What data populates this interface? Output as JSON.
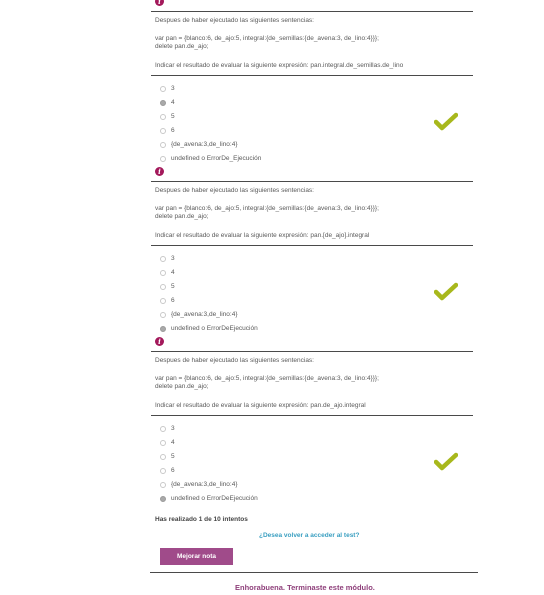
{
  "questions": [
    {
      "intro": "Despues de haber ejecutado las siguientes sentencias:",
      "code_line1": "var pan = {blanco:6, de_ajo:5, integral:{de_semillas:{de_avena:3, de_lino:4}}};",
      "code_line2": "delete pan.de_ajo;",
      "prompt": "Indicar el resultado de evaluar la siguiente expresión: pan.integral.de_semillas.de_lino",
      "options": [
        "3",
        "4",
        "5",
        "6",
        "{de_avena:3,de_lino:4}",
        "undefined o ErrorDe_Ejecución"
      ],
      "selected_index": 1,
      "result": "correct"
    },
    {
      "intro": "Despues de haber ejecutado las siguientes sentencias:",
      "code_line1": "var pan = {blanco:6, de_ajo:5, integral:{de_semillas:{de_avena:3, de_lino:4}}};",
      "code_line2": "delete pan.de_ajo;",
      "prompt": "Indicar el resultado de evaluar la siguiente expresión: pan.[de_ajo].integral",
      "options": [
        "3",
        "4",
        "5",
        "6",
        "{de_avena:3,de_lino:4}",
        "undefined o ErrorDeEjecución"
      ],
      "selected_index": 5,
      "result": "correct"
    },
    {
      "intro": "Despues de haber ejecutado las siguientes sentencias:",
      "code_line1": "var pan = {blanco:6, de_ajo:5, integral:{de_semillas:{de_avena:3, de_lino:4}}};",
      "code_line2": "delete pan.de_ajo;",
      "prompt": "Indicar el resultado de evaluar la siguiente expresión: pan.de_ajo.integral",
      "options": [
        "3",
        "4",
        "5",
        "6",
        "{de_avena:3,de_lino:4}",
        "undefined o ErrorDeEjecución"
      ],
      "selected_index": 5,
      "result": "correct"
    }
  ],
  "footer": {
    "attempts_text": "Has realizado 1 de 10 intentos",
    "retry_link": "¿Desea volver a acceder al test?",
    "improve_button": "Mejorar nota",
    "congrats": "Enhorabuena. Terminaste este módulo."
  },
  "colors": {
    "info_icon": "#a3195b",
    "checkmark": "#a8b81c",
    "button": "#a04b8a",
    "link": "#3a9fc1"
  },
  "icons": [
    "info-icon",
    "checkmark-icon",
    "radio-icon"
  ]
}
